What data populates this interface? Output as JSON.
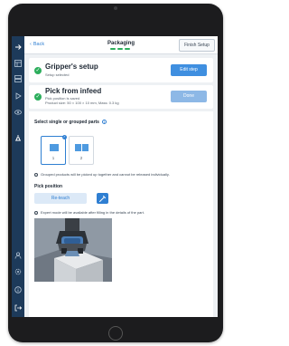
{
  "colors": {
    "accent": "#2f7fd2",
    "success": "#2cae5c",
    "sidebar": "#1d3a5a",
    "button_blue": "#3f8fe0",
    "button_disabled": "#8db8e6"
  },
  "sidebar": {
    "items": [
      {
        "icon": "arrow-right-icon"
      },
      {
        "icon": "grid-icon"
      },
      {
        "icon": "layers-icon"
      },
      {
        "icon": "play-icon"
      },
      {
        "icon": "eye-icon"
      },
      {
        "icon": "robot-icon"
      },
      {
        "icon": "user-icon"
      },
      {
        "icon": "settings-icon"
      },
      {
        "icon": "info-icon"
      },
      {
        "icon": "logout-icon"
      }
    ]
  },
  "header": {
    "back_label": "Back",
    "title": "Packaging",
    "finish_label": "Finish Setup"
  },
  "gripper_card": {
    "title": "Gripper's setup",
    "subtitle": "Setup selected",
    "button_label": "Edit step"
  },
  "pick_card": {
    "title": "Pick from infeed",
    "line1": "Pick position is saved",
    "line2": "Product size: 50 × 100 × 10 mm, Mass: 0.3 kg",
    "button_label": "Done"
  },
  "parts": {
    "label": "Select single or grouped parts",
    "options": [
      {
        "number": "1",
        "selected": true
      },
      {
        "number": "2",
        "selected": false
      }
    ],
    "note": "Grouped products will be picked up together and cannot be released individually."
  },
  "pick_position": {
    "label": "Pick position",
    "reteach_label": "Re-teach",
    "note": "Expert mode will be available after filling in the details of the part."
  }
}
